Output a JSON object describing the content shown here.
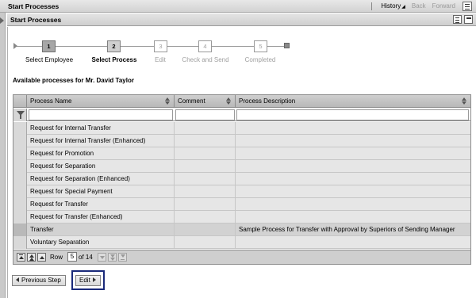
{
  "window": {
    "title": "Start Processes"
  },
  "nav": {
    "history": "History",
    "back": "Back",
    "forward": "Forward"
  },
  "panel": {
    "title": "Start Processes"
  },
  "roadmap": {
    "steps": [
      {
        "number": "1",
        "label": "Select Employee",
        "state": "done"
      },
      {
        "number": "2",
        "label": "Select Process",
        "state": "current"
      },
      {
        "number": "3",
        "label": "Edit",
        "state": "future"
      },
      {
        "number": "4",
        "label": "Check and Send",
        "state": "future"
      },
      {
        "number": "5",
        "label": "Completed",
        "state": "future"
      }
    ]
  },
  "heading": "Available processes for Mr. David Taylor",
  "table": {
    "columns": [
      "Process Name",
      "Comment",
      "Process Description"
    ],
    "rows": [
      {
        "name": "Request for Internal Transfer",
        "comment": "",
        "description": ""
      },
      {
        "name": "Request for Internal Transfer (Enhanced)",
        "comment": "",
        "description": ""
      },
      {
        "name": "Request for Promotion",
        "comment": "",
        "description": ""
      },
      {
        "name": "Request for Separation",
        "comment": "",
        "description": ""
      },
      {
        "name": "Request for Separation (Enhanced)",
        "comment": "",
        "description": ""
      },
      {
        "name": "Request for Special Payment",
        "comment": "",
        "description": ""
      },
      {
        "name": "Request for Transfer",
        "comment": "",
        "description": ""
      },
      {
        "name": "Request for Transfer (Enhanced)",
        "comment": "",
        "description": ""
      },
      {
        "name": "Transfer",
        "comment": "",
        "description": "Sample Process for Transfer with Approval by Superiors of Sending Manager",
        "selected": true
      },
      {
        "name": "Voluntary Separation",
        "comment": "",
        "description": ""
      }
    ]
  },
  "pager": {
    "row_label": "Row",
    "current": "5",
    "of_label": "of 14"
  },
  "buttons": {
    "previous": "Previous Step",
    "edit": "Edit"
  }
}
